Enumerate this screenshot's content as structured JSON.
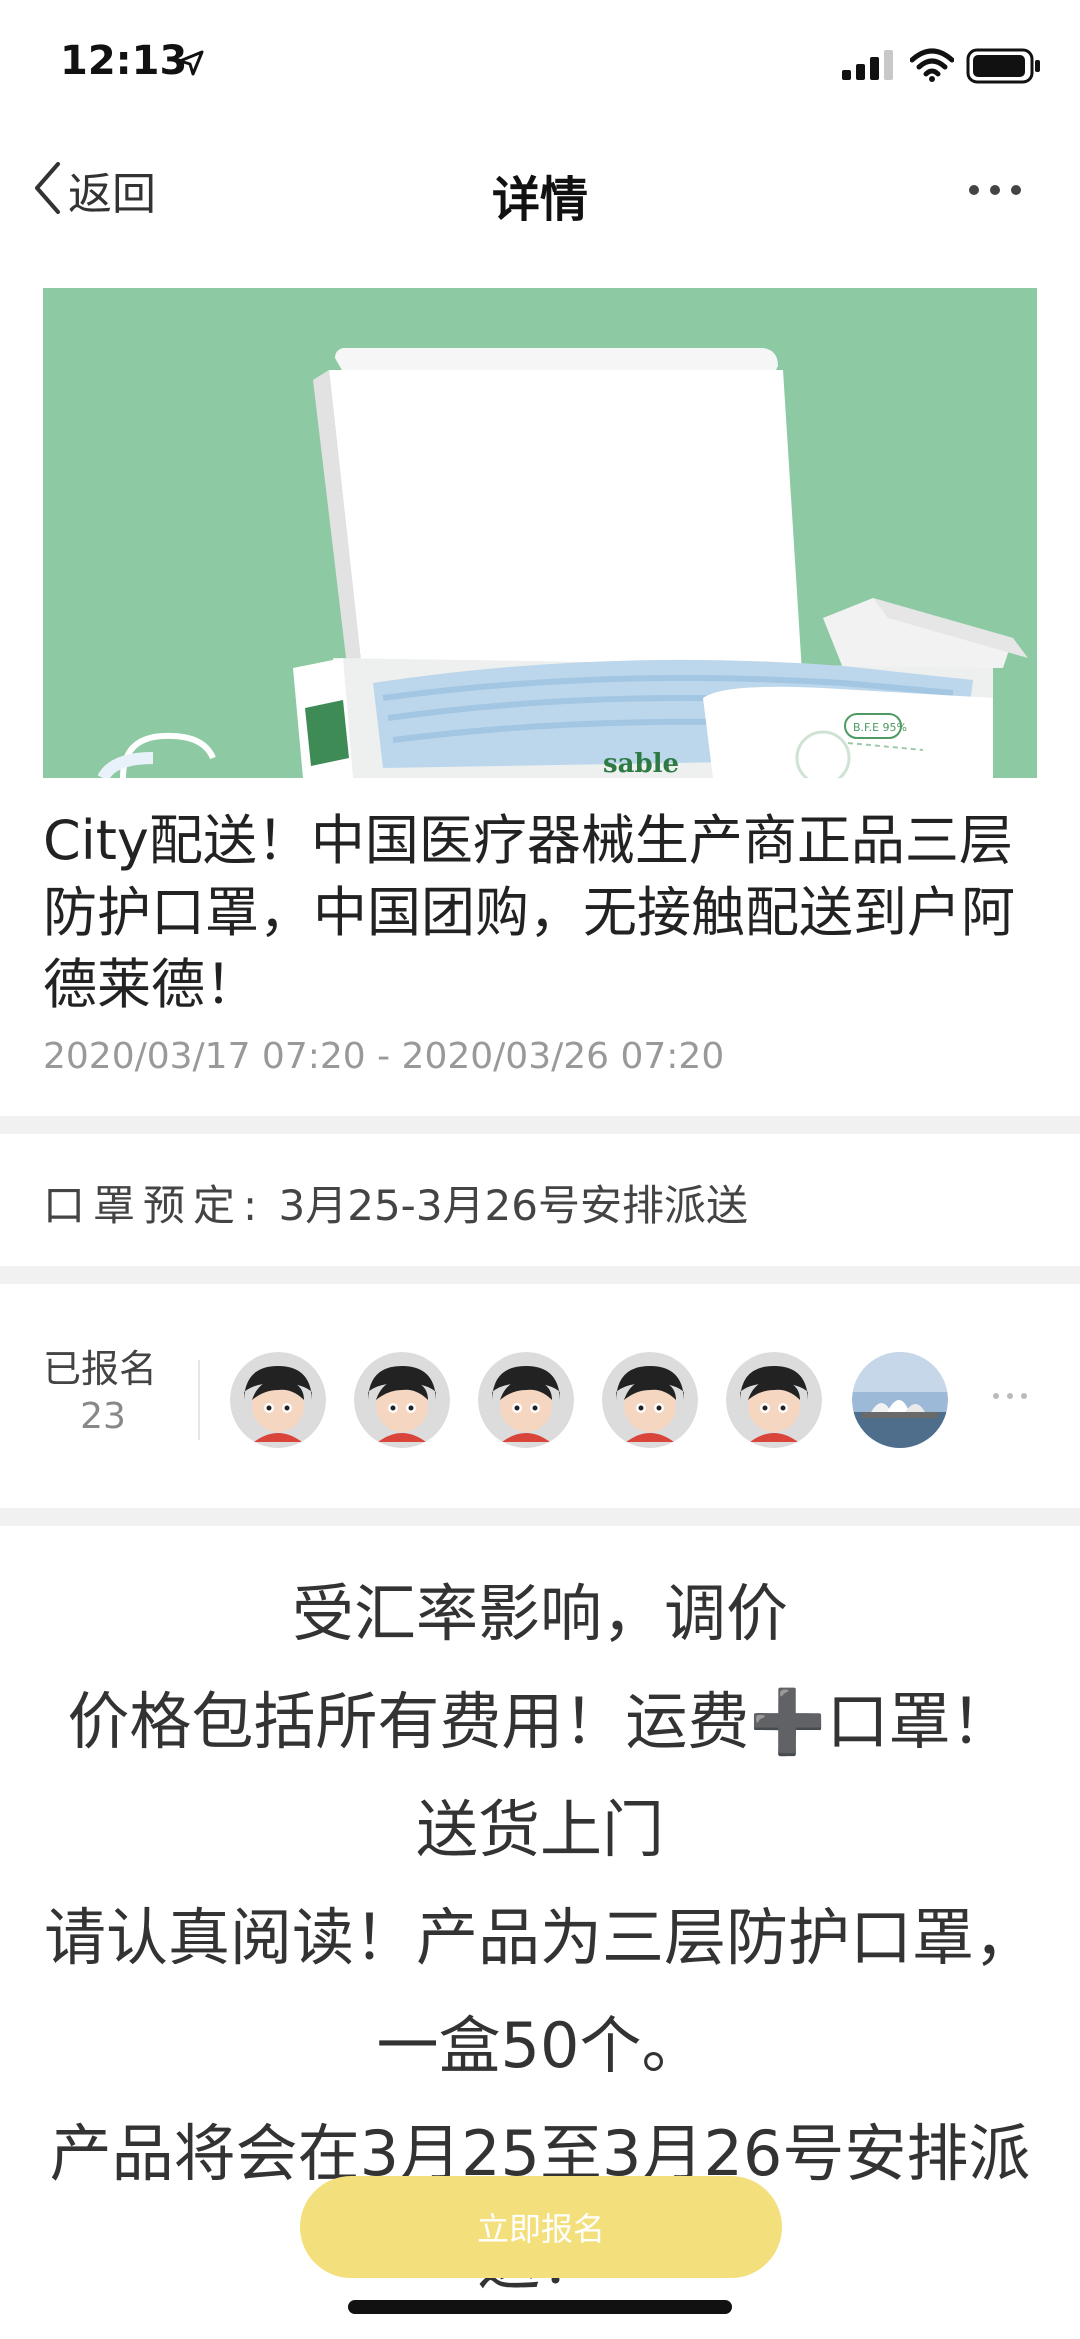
{
  "status_bar": {
    "time": "12:13"
  },
  "nav": {
    "back_label": "返回",
    "title": "详情"
  },
  "hero_image": {
    "box_print": "sable",
    "badge": "B.F.E 95%"
  },
  "product": {
    "title": "City配送！中国医疗器械生产商正品三层防护口罩，中国团购，无接触配送到户阿德莱德！",
    "date_range": "2020/03/17 07:20 - 2020/03/26 07:20"
  },
  "mask_booking": {
    "label": "口罩预定:",
    "value": "3月25-3月26号安排派送"
  },
  "signup": {
    "label": "已报名",
    "count": "23"
  },
  "description": {
    "lines": [
      "受汇率影响，调价",
      "价格包括所有费用！运费➕口罩！送货上门",
      "请认真阅读！产品为三层防护口罩，一盒50个。",
      "产品将会在3月25至3月26号安排派送！"
    ]
  },
  "cta": {
    "label": "立即报名"
  },
  "colors": {
    "accent": "#f3df7c",
    "hero_bg": "#8dc9a3"
  }
}
